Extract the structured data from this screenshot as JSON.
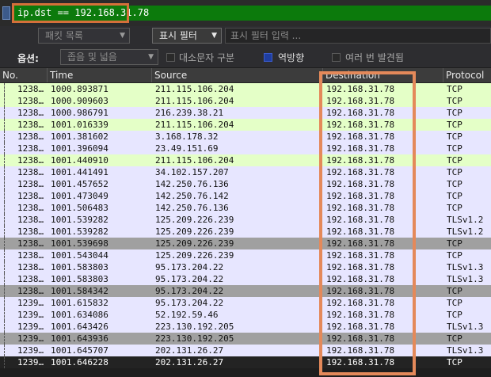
{
  "filter": {
    "value": "ip.dst == 192.168.31.78"
  },
  "toolbar": {
    "packet_list_combo": "패킷 목록",
    "display_filter_combo": "표시 필터",
    "search_placeholder": "표시 필터 입력 ...",
    "options_label": "옵션:",
    "narrow_wide_combo": "좁음 및 넓음",
    "case_sensitive": "대소문자 구분",
    "reverse": "역방향",
    "multiple_found": "여러 번 발견됨"
  },
  "columns": {
    "no": "No.",
    "time": "Time",
    "source": "Source",
    "destination": "Destination",
    "protocol": "Protocol"
  },
  "packets": [
    {
      "no": "1238…",
      "time": "1000.893871",
      "source": "211.115.106.204",
      "destination": "192.168.31.78",
      "protocol": "TCP",
      "color": "green"
    },
    {
      "no": "1238…",
      "time": "1000.909603",
      "source": "211.115.106.204",
      "destination": "192.168.31.78",
      "protocol": "TCP",
      "color": "green"
    },
    {
      "no": "1238…",
      "time": "1000.986791",
      "source": "216.239.38.21",
      "destination": "192.168.31.78",
      "protocol": "TCP",
      "color": "lav"
    },
    {
      "no": "1238…",
      "time": "1001.016339",
      "source": "211.115.106.204",
      "destination": "192.168.31.78",
      "protocol": "TCP",
      "color": "green"
    },
    {
      "no": "1238…",
      "time": "1001.381602",
      "source": "3.168.178.32",
      "destination": "192.168.31.78",
      "protocol": "TCP",
      "color": "lav"
    },
    {
      "no": "1238…",
      "time": "1001.396094",
      "source": "23.49.151.69",
      "destination": "192.168.31.78",
      "protocol": "TCP",
      "color": "lav"
    },
    {
      "no": "1238…",
      "time": "1001.440910",
      "source": "211.115.106.204",
      "destination": "192.168.31.78",
      "protocol": "TCP",
      "color": "green"
    },
    {
      "no": "1238…",
      "time": "1001.441491",
      "source": "34.102.157.207",
      "destination": "192.168.31.78",
      "protocol": "TCP",
      "color": "lav"
    },
    {
      "no": "1238…",
      "time": "1001.457652",
      "source": "142.250.76.136",
      "destination": "192.168.31.78",
      "protocol": "TCP",
      "color": "lav"
    },
    {
      "no": "1238…",
      "time": "1001.473049",
      "source": "142.250.76.142",
      "destination": "192.168.31.78",
      "protocol": "TCP",
      "color": "lav"
    },
    {
      "no": "1238…",
      "time": "1001.506483",
      "source": "142.250.76.136",
      "destination": "192.168.31.78",
      "protocol": "TCP",
      "color": "lav"
    },
    {
      "no": "1238…",
      "time": "1001.539282",
      "source": "125.209.226.239",
      "destination": "192.168.31.78",
      "protocol": "TLSv1.2",
      "color": "lav"
    },
    {
      "no": "1238…",
      "time": "1001.539282",
      "source": "125.209.226.239",
      "destination": "192.168.31.78",
      "protocol": "TLSv1.2",
      "color": "lav"
    },
    {
      "no": "1238…",
      "time": "1001.539698",
      "source": "125.209.226.239",
      "destination": "192.168.31.78",
      "protocol": "TCP",
      "color": "gray"
    },
    {
      "no": "1238…",
      "time": "1001.543044",
      "source": "125.209.226.239",
      "destination": "192.168.31.78",
      "protocol": "TCP",
      "color": "lav"
    },
    {
      "no": "1238…",
      "time": "1001.583803",
      "source": "95.173.204.22",
      "destination": "192.168.31.78",
      "protocol": "TLSv1.3",
      "color": "lav"
    },
    {
      "no": "1238…",
      "time": "1001.583803",
      "source": "95.173.204.22",
      "destination": "192.168.31.78",
      "protocol": "TLSv1.3",
      "color": "lav"
    },
    {
      "no": "1238…",
      "time": "1001.584342",
      "source": "95.173.204.22",
      "destination": "192.168.31.78",
      "protocol": "TCP",
      "color": "gray"
    },
    {
      "no": "1239…",
      "time": "1001.615832",
      "source": "95.173.204.22",
      "destination": "192.168.31.78",
      "protocol": "TCP",
      "color": "lav"
    },
    {
      "no": "1239…",
      "time": "1001.634086",
      "source": "52.192.59.46",
      "destination": "192.168.31.78",
      "protocol": "TCP",
      "color": "lav"
    },
    {
      "no": "1239…",
      "time": "1001.643426",
      "source": "223.130.192.205",
      "destination": "192.168.31.78",
      "protocol": "TLSv1.3",
      "color": "lav"
    },
    {
      "no": "1239…",
      "time": "1001.643936",
      "source": "223.130.192.205",
      "destination": "192.168.31.78",
      "protocol": "TCP",
      "color": "gray"
    },
    {
      "no": "1239…",
      "time": "1001.645707",
      "source": "202.131.26.27",
      "destination": "192.168.31.78",
      "protocol": "TLSv1.3",
      "color": "lav"
    },
    {
      "no": "1239…",
      "time": "1001.646228",
      "source": "202.131.26.27",
      "destination": "192.168.31.78",
      "protocol": "TCP",
      "color": "dark"
    }
  ]
}
